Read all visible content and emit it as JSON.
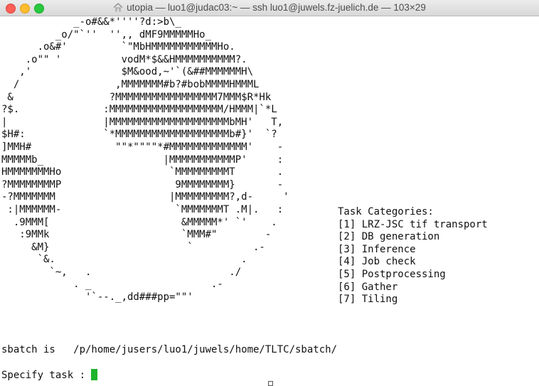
{
  "window": {
    "title": "utopia — luo1@judac03:~ — ssh luo1@juwels.fz-juelich.de — 103×29",
    "controls": {
      "close": "close",
      "minimize": "minimize",
      "maximize": "maximize"
    }
  },
  "terminal": {
    "ascii_logo": "            _-o#&&*''''?d:>b\\_\n         _o/\"`''  '',, dMF9MMMMMHo_\n      .o&#'         `\"MbHMMMMMMMMMMMHo.\n    .o\"\" '          vodM*$&&HMMMMMMMMMM?.\n   ,'               $M&ood,~'`(&##MMMMMMH\\\n  /                ,MMMMMMM#b?#bobMMMMHMMML\n &                ?MMMMMMMMMMMMMMMMM7MMM$R*Hk\n?$.              :MMMMMMMMMMMMMMMMMMM/HMMM|`*L\n|                |MMMMMMMMMMMMMMMMMMMMbMH'   T,\n$H#:             `*MMMMMMMMMMMMMMMMMMMb#}'  `?\n]MMH#              \"\"*\"\"\"\"*#MMMMMMMMMMMMM'    -\nMMMMMb_                    |MMMMMMMMMMMP'     :\nHMMMMMMMHo                  `MMMMMMMMMT       .\n?MMMMMMMMP                   9MMMMMMMM}       -\n-?MMMMMMM                   |MMMMMMMMM?,d-     '\n :|MMMMMM-                   `MMMMMMMT .M|.   :\n  .9MMM[                      &MMMMM*' `'    .\n   :9MMk                      `MMM#\"        -\n     &M}                       `          .-\n      `&.                               .\n        `~,   .                       ./\n            . _                    .-\n              '`--._,dd###pp=\"\"'",
    "task_categories": {
      "heading": "Task Categories:",
      "items": [
        "[1] LRZ-JSC tif transport",
        "[2] DB generation",
        "[3] Inference",
        "[4] Job check",
        "[5] Postprocessing",
        "[6] Gather",
        "[7] Tiling"
      ]
    },
    "sbatch_line": "sbatch is   /p/home/jusers/luo1/juwels/home/TLTC/sbatch/",
    "prompt": "Specify task : ",
    "cursor_color": "#1fb32c"
  }
}
